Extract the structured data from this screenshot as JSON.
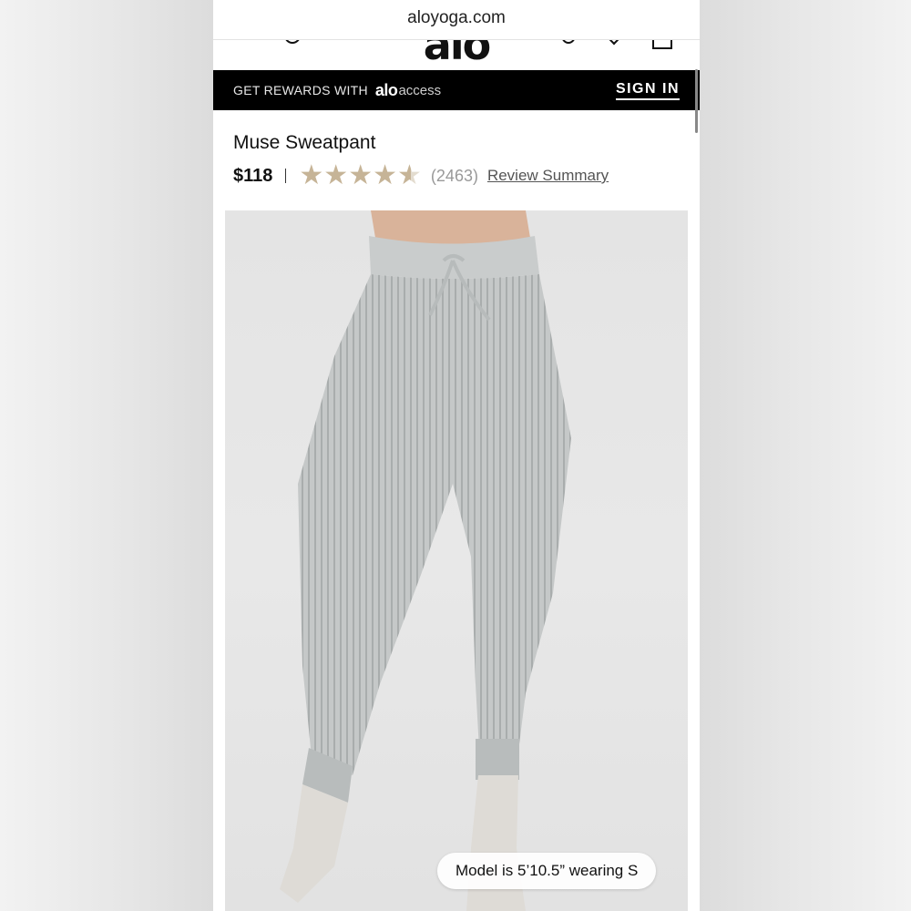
{
  "browser": {
    "url": "aloyoga.com"
  },
  "header": {
    "logo": "alo",
    "icons": [
      "menu-icon",
      "search-icon",
      "account-icon",
      "wishlist-icon",
      "bag-icon"
    ]
  },
  "rewards": {
    "text": "GET REWARDS WITH",
    "brand_alo": "alo",
    "brand_access": "access",
    "sign_in_label": "SIGN IN"
  },
  "product": {
    "title": "Muse Sweatpant",
    "price": "$118",
    "rating": 4.5,
    "rating_max": 5,
    "review_count": "(2463)",
    "review_link": "Review Summary",
    "model_info": "Model is 5’10.5” wearing S",
    "image_description_colors": {
      "pant": "#c3c6c6",
      "sock": "#dedbd6",
      "skin": "#d9b39a"
    }
  },
  "colors": {
    "rewards_bg": "#000000",
    "star": "#c6b497",
    "link": "#555555"
  }
}
